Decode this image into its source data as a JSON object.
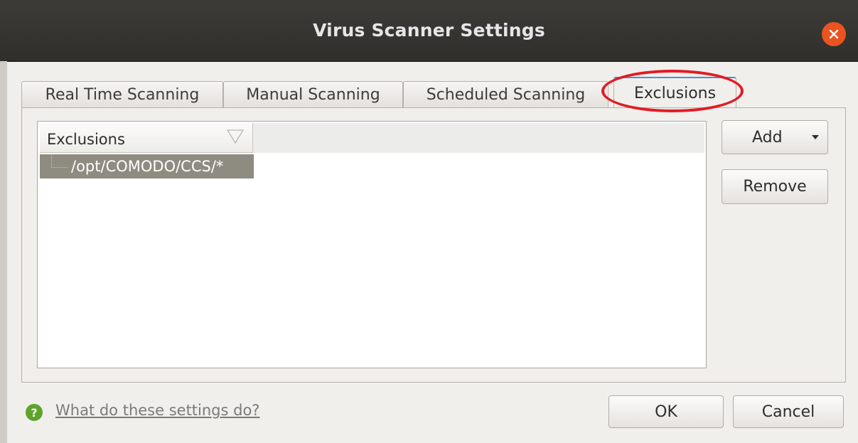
{
  "window": {
    "title": "Virus Scanner Settings",
    "close_icon": "close-icon"
  },
  "tabs": [
    {
      "label": "Real Time Scanning",
      "active": false
    },
    {
      "label": "Manual Scanning",
      "active": false
    },
    {
      "label": "Scheduled Scanning",
      "active": false
    },
    {
      "label": "Exclusions",
      "active": true
    }
  ],
  "exclusions_list": {
    "column_header": "Exclusions",
    "sort_icon": "sort-indicator-icon",
    "items": [
      "/opt/COMODO/CCS/*"
    ],
    "selected_index": 0
  },
  "buttons": {
    "add": "Add",
    "remove": "Remove",
    "ok": "OK",
    "cancel": "Cancel"
  },
  "footer": {
    "help_icon": "help-icon",
    "help_link": "What do these settings do?"
  },
  "colors": {
    "titlebar": "#3c3b37",
    "close_button": "#e95420",
    "selection": "#8e8b80",
    "annotation": "#e21b23",
    "help_icon": "#5ea32b"
  }
}
